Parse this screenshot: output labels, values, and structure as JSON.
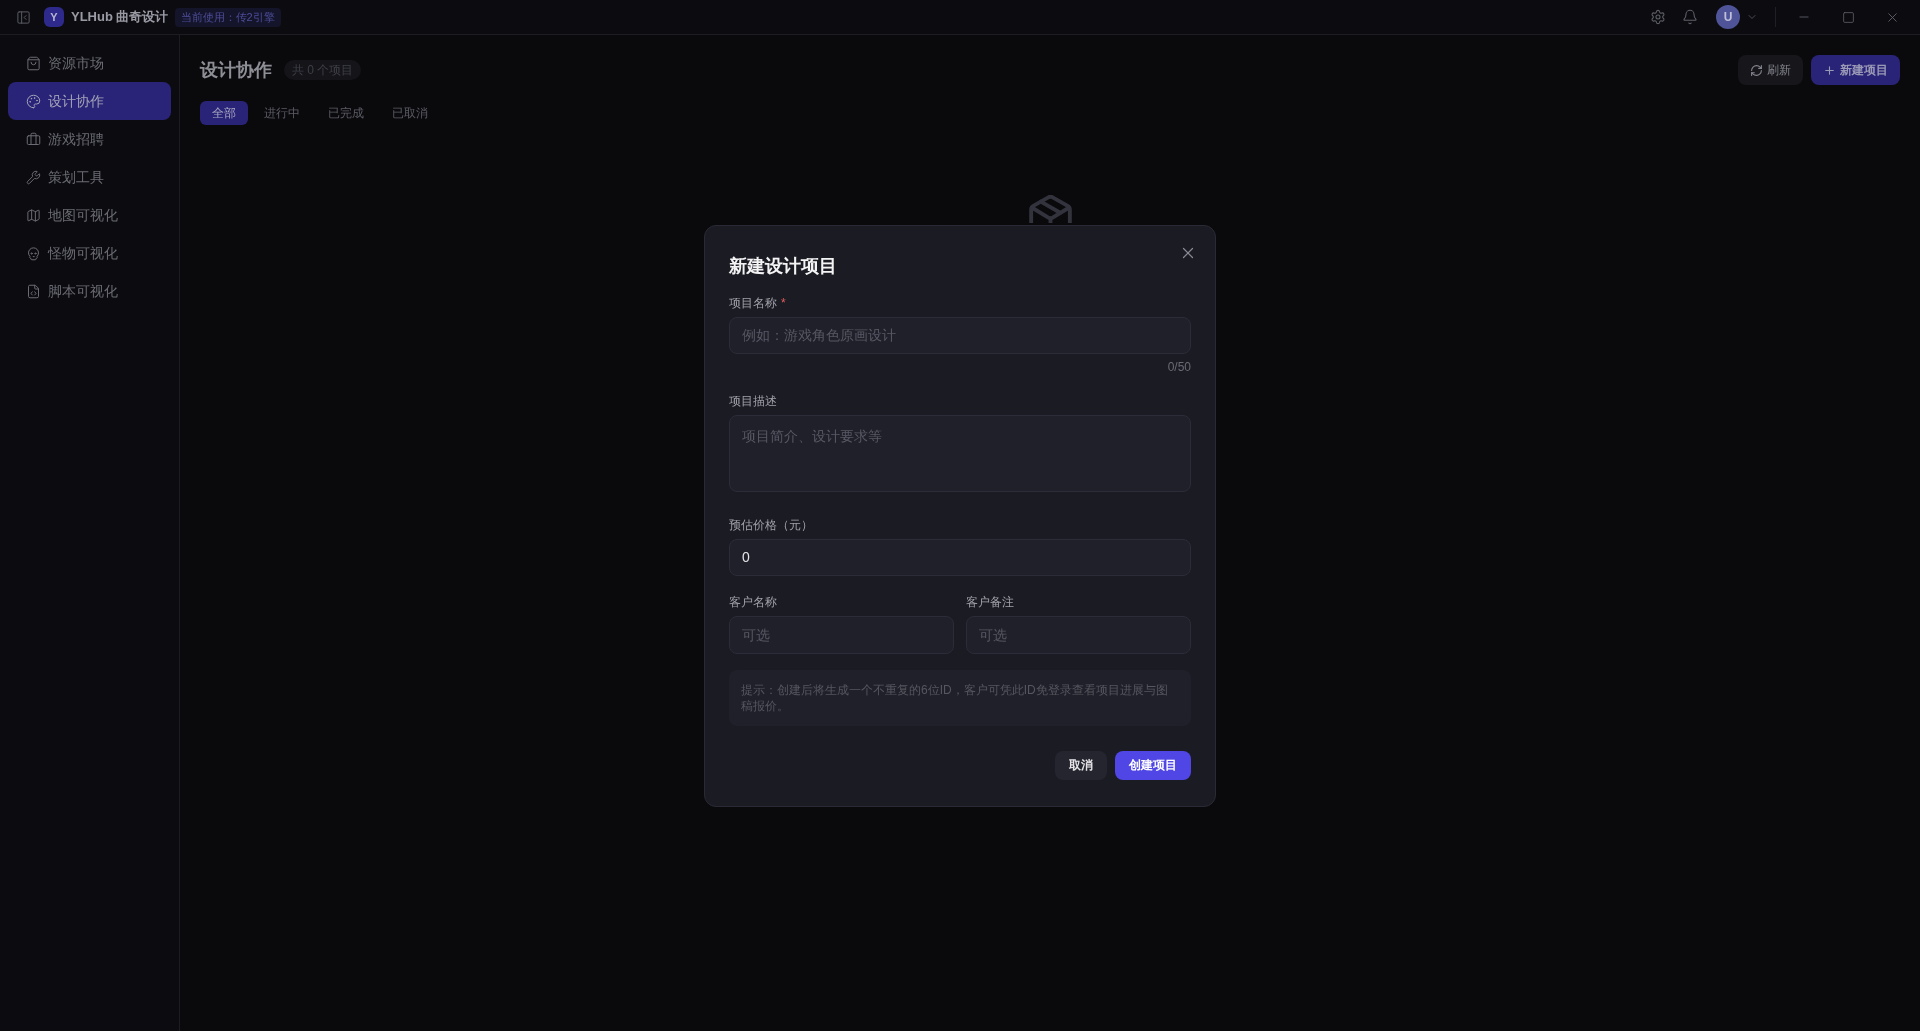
{
  "title_bar": {
    "logo_letter": "Y",
    "app_name": "YLHub 曲奇设计",
    "engine_badge": "当前使用：传2引擎",
    "avatar_letter": "U"
  },
  "sidebar": {
    "items": [
      {
        "label": "资源市场",
        "selected": false
      },
      {
        "label": "设计协作",
        "selected": true
      },
      {
        "label": "游戏招聘",
        "selected": false
      },
      {
        "label": "策划工具",
        "selected": false
      },
      {
        "label": "地图可视化",
        "selected": false
      },
      {
        "label": "怪物可视化",
        "selected": false
      },
      {
        "label": "脚本可视化",
        "selected": false
      }
    ]
  },
  "page": {
    "title": "设计协作",
    "count_badge": "共 0 个项目",
    "actions": [
      {
        "label": "刷新",
        "kind": "secondary"
      },
      {
        "label": "新建项目",
        "kind": "primary"
      }
    ],
    "tabs": [
      {
        "label": "全部",
        "selected": true
      },
      {
        "label": "进行中",
        "selected": false
      },
      {
        "label": "已完成",
        "selected": false
      },
      {
        "label": "已取消",
        "selected": false
      }
    ]
  },
  "dialog": {
    "title": "新建设计项目",
    "fields": [
      {
        "kind": "input",
        "label": "项目名称",
        "required_mark": "*",
        "placeholder": "例如：游戏角色原画设计",
        "counter": "0/50"
      },
      {
        "kind": "textarea",
        "label": "项目描述",
        "placeholder": "项目简介、设计要求等"
      },
      {
        "kind": "input",
        "label": "预估价格（元）",
        "value": "0"
      }
    ],
    "customer_fields": [
      {
        "label": "客户名称",
        "placeholder": "可选"
      },
      {
        "label": "客户备注",
        "placeholder": "可选"
      }
    ],
    "hint": "提示：创建后将生成一个不重复的6位ID，客户可凭此ID免登录查看项目进展与图稿报价。",
    "buttons": [
      {
        "label": "取消",
        "kind": "secondary"
      },
      {
        "label": "创建项目",
        "kind": "primary"
      }
    ]
  }
}
